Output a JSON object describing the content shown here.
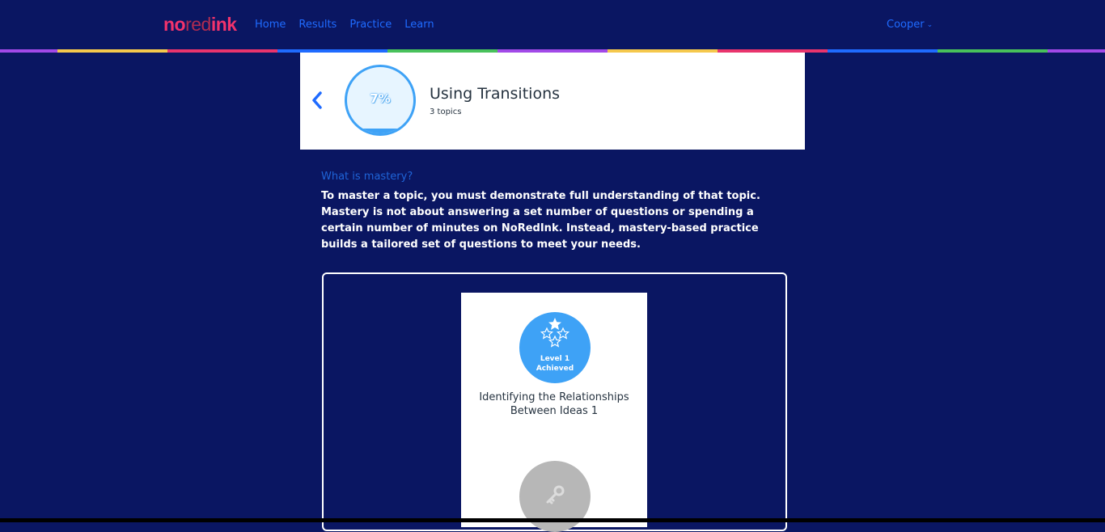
{
  "nav": {
    "logo": {
      "no": "no",
      "red": "red",
      "ink": "ink"
    },
    "links": [
      "Home",
      "Results",
      "Practice",
      "Learn"
    ],
    "user": "Cooper",
    "stripe_colors": [
      "#a249e8",
      "#f5c84c",
      "#e9346d",
      "#1f6bff",
      "#48c15b",
      "#a249e8",
      "#f5c84c",
      "#e9346d",
      "#1f6bff",
      "#48c15b",
      "#a249e8"
    ]
  },
  "unit": {
    "progress_text": "7%",
    "progress_fraction": 0.07,
    "title": "Using Transitions",
    "subtitle": "3 topics"
  },
  "mastery": {
    "heading": "What is mastery?",
    "body": "To master a topic, you must demonstrate full understanding of that topic. Mastery is not about answering a set number of questions or spending a certain number of minutes on NoRedInk. Instead, mastery-based practice builds a tailored set of questions to meet your needs."
  },
  "topics": [
    {
      "level_line1": "Level 1",
      "level_line2": "Achieved",
      "name": "Identifying the Relationships Between Ideas 1",
      "status": "achieved"
    },
    {
      "status": "locked"
    }
  ],
  "colors": {
    "background": "#0a1662",
    "accent": "#3ea2f6",
    "link": "#1f6bff",
    "brand": "#f3336c"
  }
}
